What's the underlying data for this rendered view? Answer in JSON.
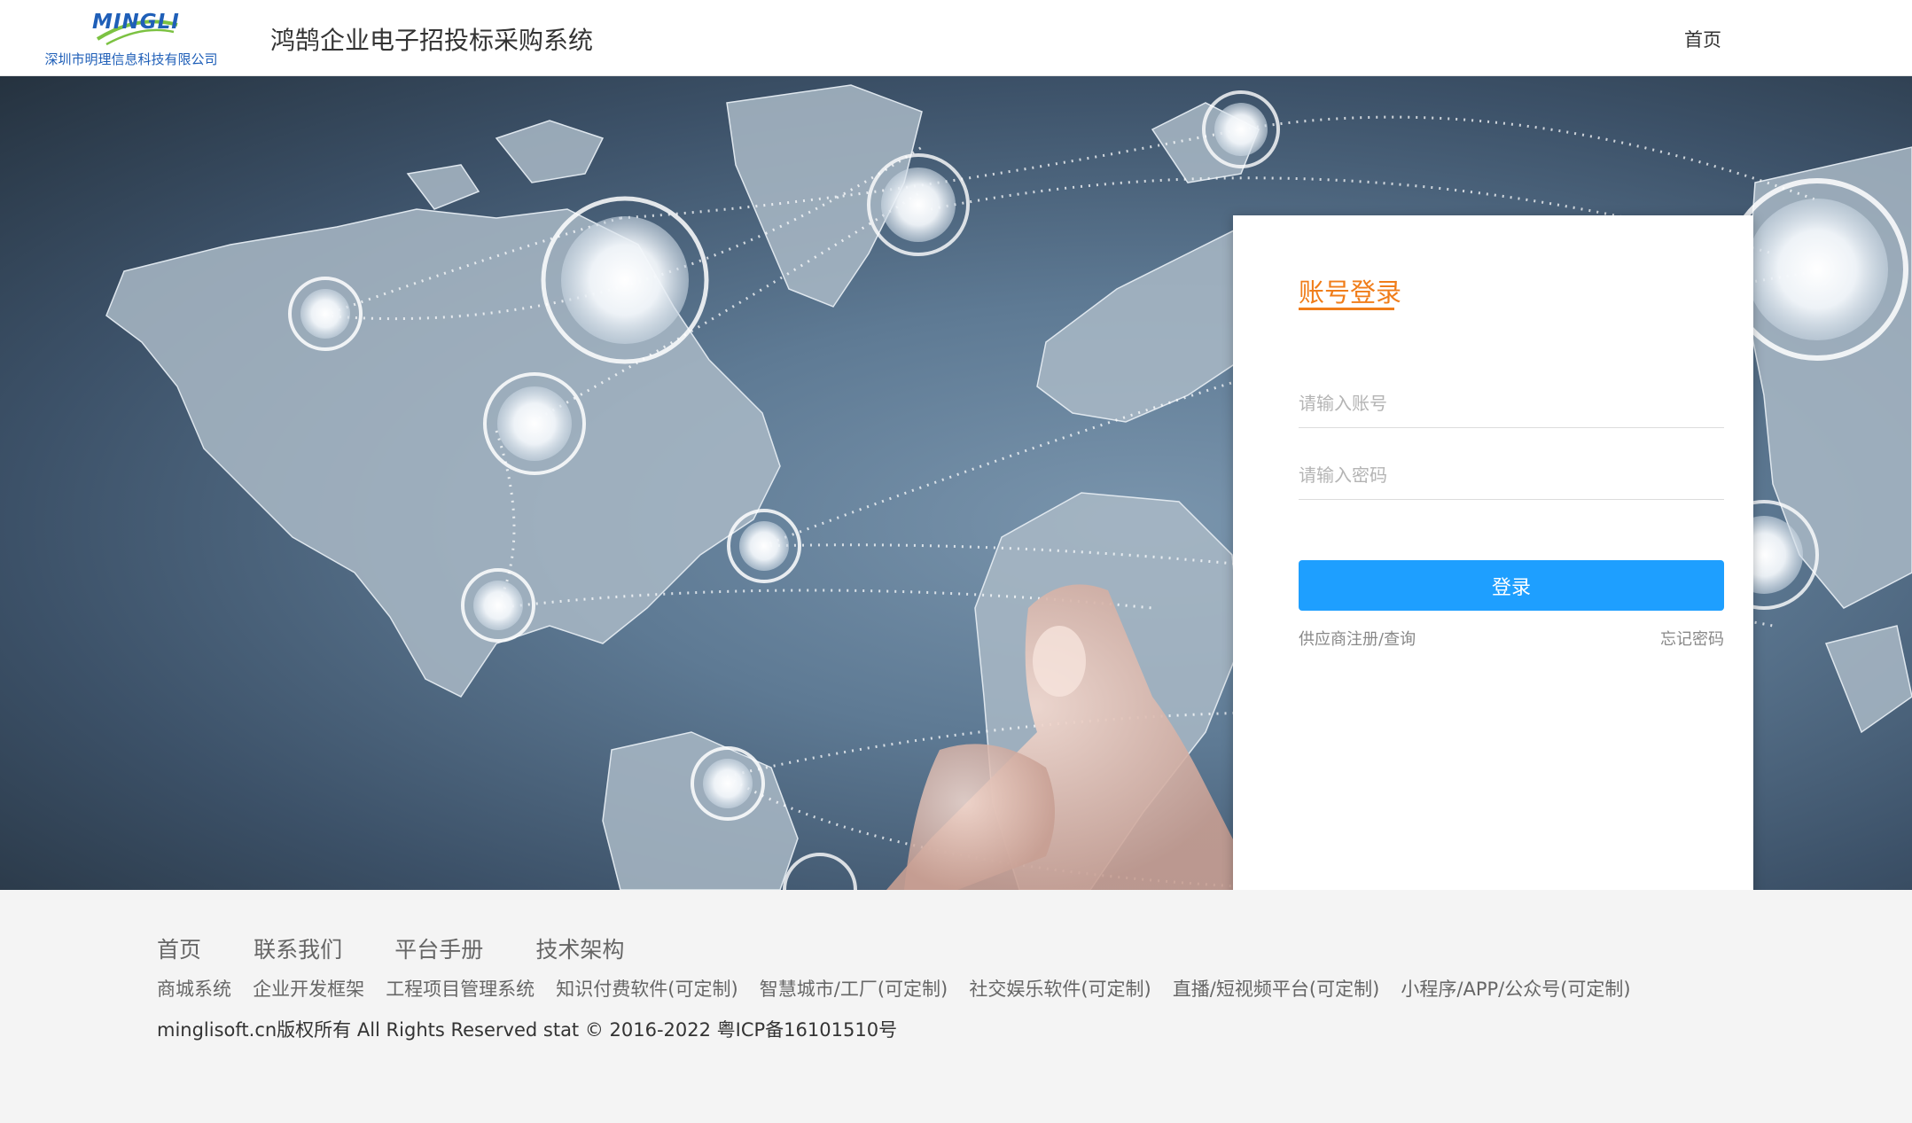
{
  "header": {
    "logo_word": "MINGLI",
    "company_name": "深圳市明理信息科技有限公司",
    "system_title": "鸿鹄企业电子招投标采购系统",
    "nav_home": "首页"
  },
  "login": {
    "title": "账号登录",
    "account_placeholder": "请输入账号",
    "password_placeholder": "请输入密码",
    "submit_label": "登录",
    "register_link": "供应商注册/查询",
    "forgot_link": "忘记密码",
    "accent_color": "#f07d1a",
    "button_color": "#1e9fff"
  },
  "footer": {
    "nav": [
      "首页",
      "联系我们",
      "平台手册",
      "技术架构"
    ],
    "products": [
      "商城系统",
      "企业开发框架",
      "工程项目管理系统",
      "知识付费软件(可定制)",
      "智慧城市/工厂(可定制)",
      "社交娱乐软件(可定制)",
      "直播/短视频平台(可定制)",
      "小程序/APP/公众号(可定制)"
    ],
    "copyright": "minglisoft.cn版权所有 All Rights Reserved stat © 2016-2022 粤ICP备16101510号"
  }
}
